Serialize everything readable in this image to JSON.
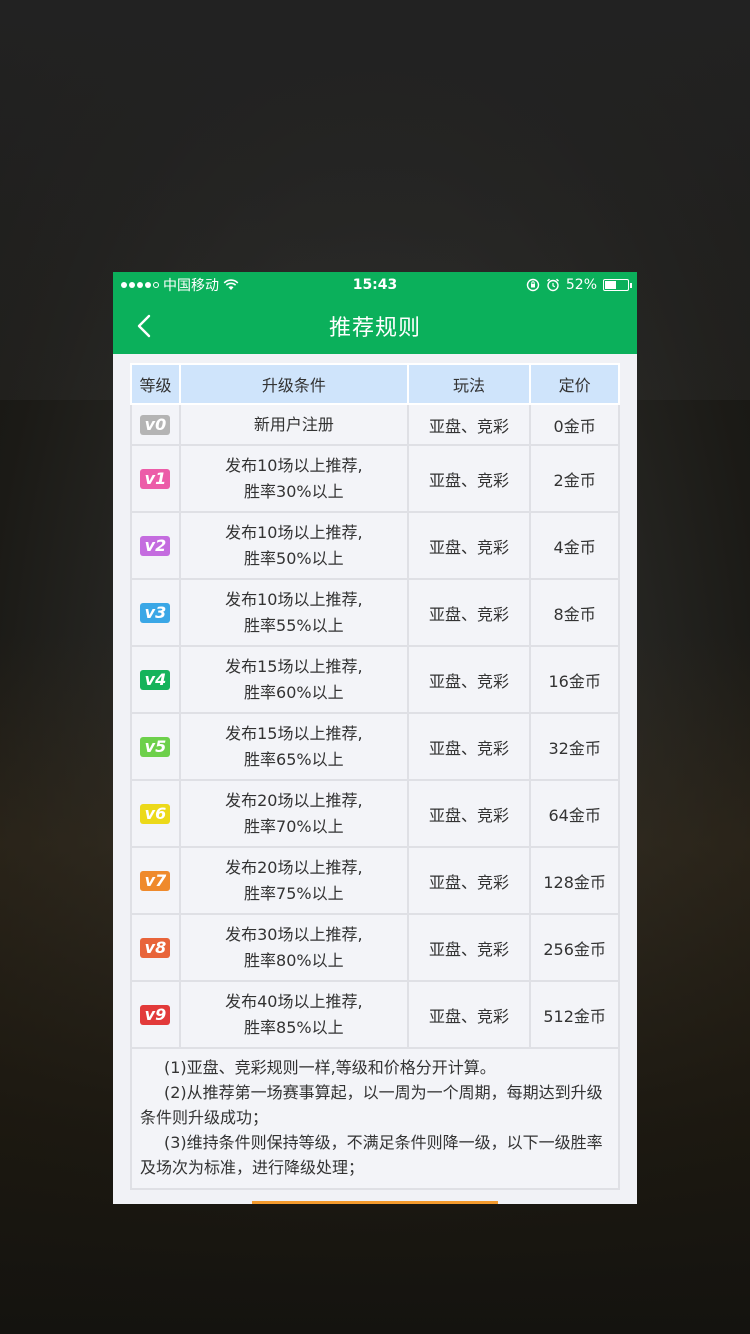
{
  "status": {
    "carrier": "中国移动",
    "time": "15:43",
    "battery": "52%",
    "battery_level": 0.52
  },
  "nav": {
    "title": "推荐规则",
    "back_icon": "chevron-left-icon"
  },
  "table": {
    "headers": [
      "等级",
      "升级条件",
      "玩法",
      "定价"
    ],
    "rows": [
      {
        "level": "v0",
        "color": "#b4b4b4",
        "cond1": "新用户注册",
        "cond2": "",
        "play": "亚盘、竞彩",
        "price": "0金币"
      },
      {
        "level": "v1",
        "color": "#ec5ca8",
        "cond1": "发布10场以上推荐,",
        "cond2": "胜率30%以上",
        "play": "亚盘、竞彩",
        "price": "2金币"
      },
      {
        "level": "v2",
        "color": "#c46cdf",
        "cond1": "发布10场以上推荐,",
        "cond2": "胜率50%以上",
        "play": "亚盘、竞彩",
        "price": "4金币"
      },
      {
        "level": "v3",
        "color": "#3aa7e6",
        "cond1": "发布10场以上推荐,",
        "cond2": "胜率55%以上",
        "play": "亚盘、竞彩",
        "price": "8金币"
      },
      {
        "level": "v4",
        "color": "#15b35b",
        "cond1": "发布15场以上推荐,",
        "cond2": "胜率60%以上",
        "play": "亚盘、竞彩",
        "price": "16金币"
      },
      {
        "level": "v5",
        "color": "#6dd04b",
        "cond1": "发布15场以上推荐,",
        "cond2": "胜率65%以上",
        "play": "亚盘、竞彩",
        "price": "32金币"
      },
      {
        "level": "v6",
        "color": "#ecd91a",
        "cond1": "发布20场以上推荐,",
        "cond2": "胜率70%以上",
        "play": "亚盘、竞彩",
        "price": "64金币"
      },
      {
        "level": "v7",
        "color": "#ef8a2c",
        "cond1": "发布20场以上推荐,",
        "cond2": "胜率75%以上",
        "play": "亚盘、竞彩",
        "price": "128金币"
      },
      {
        "level": "v8",
        "color": "#e8643a",
        "cond1": "发布30场以上推荐,",
        "cond2": "胜率80%以上",
        "play": "亚盘、竞彩",
        "price": "256金币"
      },
      {
        "level": "v9",
        "color": "#e23a3a",
        "cond1": "发布40场以上推荐,",
        "cond2": "胜率85%以上",
        "play": "亚盘、竞彩",
        "price": "512金币"
      }
    ]
  },
  "rules": {
    "line1": "(1)亚盘、竞彩规则一样,等级和价格分开计算。",
    "line2": "(2)从推荐第一场赛事算起，以一周为一个周期，每期达到升级条件则升级成功；",
    "line3": "(3)维持条件则保持等级，不满足条件则降一级，以下一级胜率及场次为标准，进行降级处理；"
  },
  "colors": {
    "brand_green": "#0bb05b",
    "header_blue": "#cfe4fb",
    "accent_orange": "#f39a2d"
  }
}
